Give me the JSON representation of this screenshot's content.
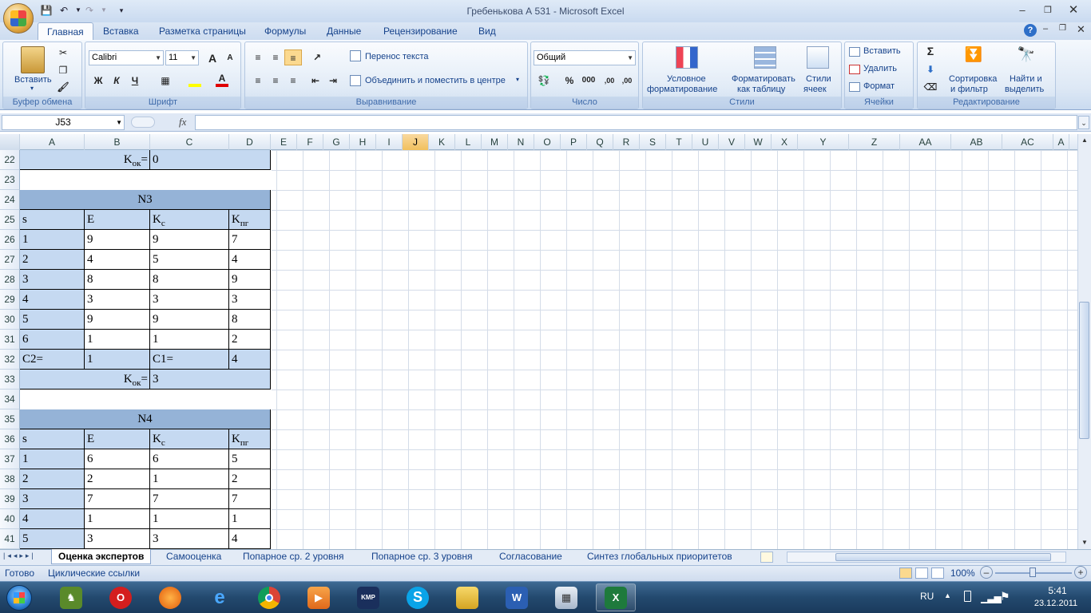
{
  "window": {
    "title": "Гребенькова А 531 - Microsoft Excel"
  },
  "qat": {
    "save": "💾",
    "undo": "↶",
    "redo": "↷"
  },
  "ribbon": {
    "tabs": [
      "Главная",
      "Вставка",
      "Разметка страницы",
      "Формулы",
      "Данные",
      "Рецензирование",
      "Вид"
    ],
    "clipboard": {
      "paste": "Вставить",
      "group": "Буфер обмена"
    },
    "font": {
      "name": "Calibri",
      "size": "11",
      "bold": "Ж",
      "italic": "К",
      "underline": "Ч",
      "grow": "A",
      "shrink": "A",
      "group": "Шрифт"
    },
    "alignment": {
      "wrap": "Перенос текста",
      "merge": "Объединить и поместить в центре",
      "group": "Выравнивание"
    },
    "number": {
      "format": "Общий",
      "percent": "%",
      "thousands": "000",
      "inc_dec": ",00",
      "dec_dec": ",00",
      "group": "Число"
    },
    "styles": {
      "cond1": "Условное",
      "cond2": "форматирование",
      "tbl1": "Форматировать",
      "tbl2": "как таблицу",
      "cell1": "Стили",
      "cell2": "ячеек",
      "group": "Стили"
    },
    "cells": {
      "insert": "Вставить",
      "delete": "Удалить",
      "format": "Формат",
      "group": "Ячейки"
    },
    "editing": {
      "sum": "Σ",
      "sort1": "Сортировка",
      "sort2": "и фильтр",
      "find1": "Найти и",
      "find2": "выделить",
      "group": "Редактирование"
    }
  },
  "formula_bar": {
    "name_box": "J53",
    "fx": "fx",
    "value": ""
  },
  "columns": [
    {
      "label": "A",
      "w": 81
    },
    {
      "label": "B",
      "w": 82
    },
    {
      "label": "C",
      "w": 99
    },
    {
      "label": "D",
      "w": 52
    },
    {
      "label": "E",
      "w": 33
    },
    {
      "label": "F",
      "w": 33
    },
    {
      "label": "G",
      "w": 33
    },
    {
      "label": "H",
      "w": 33
    },
    {
      "label": "I",
      "w": 33
    },
    {
      "label": "J",
      "w": 33
    },
    {
      "label": "K",
      "w": 33
    },
    {
      "label": "L",
      "w": 33
    },
    {
      "label": "M",
      "w": 33
    },
    {
      "label": "N",
      "w": 33
    },
    {
      "label": "O",
      "w": 33
    },
    {
      "label": "P",
      "w": 33
    },
    {
      "label": "Q",
      "w": 33
    },
    {
      "label": "R",
      "w": 33
    },
    {
      "label": "S",
      "w": 33
    },
    {
      "label": "T",
      "w": 33
    },
    {
      "label": "U",
      "w": 33
    },
    {
      "label": "V",
      "w": 33
    },
    {
      "label": "W",
      "w": 33
    },
    {
      "label": "X",
      "w": 33
    },
    {
      "label": "Y",
      "w": 64
    },
    {
      "label": "Z",
      "w": 64
    },
    {
      "label": "AA",
      "w": 64
    },
    {
      "label": "AB",
      "w": 64
    },
    {
      "label": "AC",
      "w": 64
    },
    {
      "label": "A",
      "w": 20
    }
  ],
  "selected_column": "J",
  "rows": [
    "22",
    "23",
    "24",
    "25",
    "26",
    "27",
    "28",
    "29",
    "30",
    "31",
    "32",
    "33",
    "34",
    "35",
    "36",
    "37",
    "38",
    "39",
    "40",
    "41"
  ],
  "table_n3": {
    "kok_label": "K",
    "kok_sub": "ок",
    "kok_eq": "=",
    "kok_prev": "0",
    "title": "N3",
    "headers": [
      "s",
      "E",
      "K",
      "K"
    ],
    "header_subs": [
      "",
      "",
      "с",
      "пг"
    ],
    "rows": [
      [
        "1",
        "9",
        "9",
        "7"
      ],
      [
        "2",
        "4",
        "5",
        "4"
      ],
      [
        "3",
        "8",
        "8",
        "9"
      ],
      [
        "4",
        "3",
        "3",
        "3"
      ],
      [
        "5",
        "9",
        "9",
        "8"
      ],
      [
        "6",
        "1",
        "1",
        "2"
      ]
    ],
    "c2_label": "C2=",
    "c2_value": "1",
    "c1_label": "C1=",
    "c1_value": "4",
    "kok_value": "3"
  },
  "table_n4": {
    "title": "N4",
    "headers": [
      "s",
      "E",
      "K",
      "K"
    ],
    "header_subs": [
      "",
      "",
      "с",
      "пг"
    ],
    "rows": [
      [
        "1",
        "6",
        "6",
        "5"
      ],
      [
        "2",
        "2",
        "1",
        "2"
      ],
      [
        "3",
        "7",
        "7",
        "7"
      ],
      [
        "4",
        "1",
        "1",
        "1"
      ],
      [
        "5",
        "3",
        "3",
        "4"
      ]
    ]
  },
  "sheets": [
    "Оценка экспертов",
    "Самооценка",
    "Попарное ср. 2 уровня",
    "Попарное ср. 3 уровня",
    "Согласование",
    "Синтез глобальных приоритетов"
  ],
  "active_sheet": "Оценка экспертов",
  "status": {
    "ready": "Готово",
    "circular": "Циклические ссылки",
    "zoom": "100%"
  },
  "taskbar": {
    "lang": "RU",
    "time": "5:41",
    "date": "23.12.2011"
  },
  "colors": {
    "header_blue": "#95b3d7",
    "light_blue": "#c5d9f1",
    "selected_col": "#f1c05d"
  }
}
